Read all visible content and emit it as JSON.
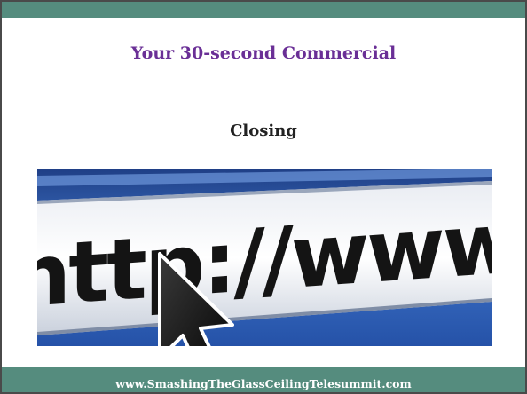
{
  "slide": {
    "title": "Your 30-second Commercial",
    "subtitle": "Closing",
    "footer": "www.SmashingTheGlassCeilingTelesummit.com",
    "image": {
      "icon": "browser-address-bar-image",
      "text": "http://www"
    }
  },
  "colors": {
    "header_bar": "#558c7e",
    "footer_bar": "#558c7e",
    "title": "#6a2f96",
    "subtitle": "#222222",
    "footer_text": "#ffffff"
  }
}
